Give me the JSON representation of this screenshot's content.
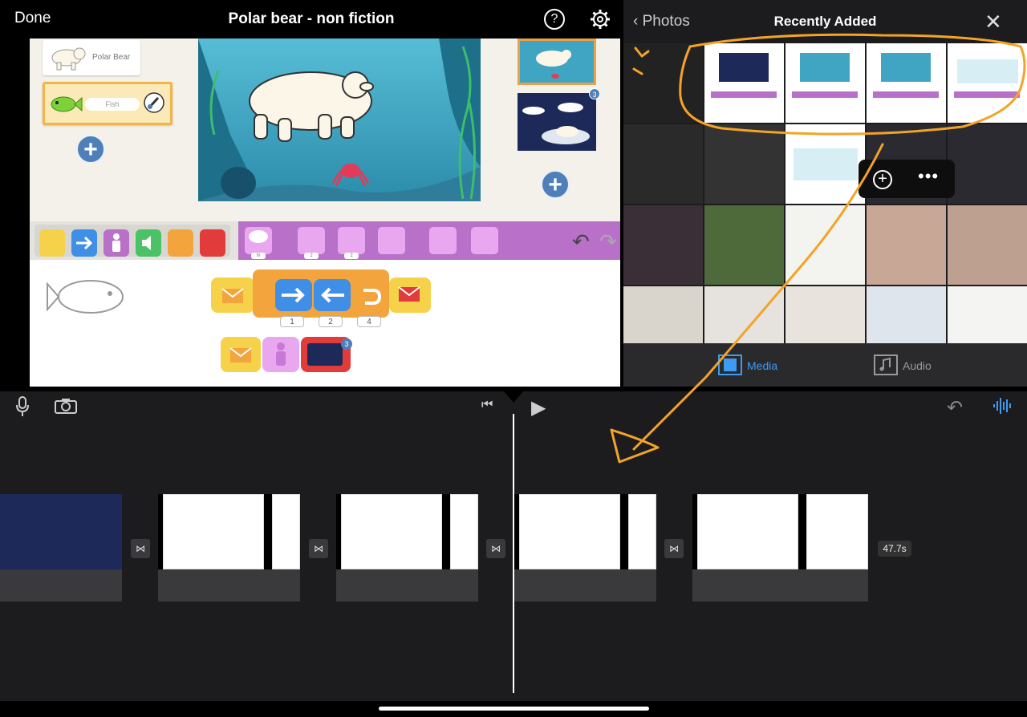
{
  "topbar": {
    "done_label": "Done",
    "title": "Polar bear - non fiction",
    "help_label": "?"
  },
  "viewer": {
    "char_cards": [
      {
        "label": "Polar Bear"
      },
      {
        "label": "Fish"
      }
    ],
    "page_badge": "3",
    "palette_tags": [
      "hi",
      "2",
      "2"
    ],
    "script_params": [
      "1",
      "2",
      "4"
    ],
    "script_badge": "3"
  },
  "media": {
    "back_label": "Photos",
    "title": "Recently Added",
    "popup_add": "+",
    "popup_more": "•••",
    "tabs": [
      {
        "label": "Media",
        "active": true,
        "color": "#3d9bf3"
      },
      {
        "label": "Audio",
        "active": false,
        "color": "#999999"
      }
    ]
  },
  "timeline": {
    "duration": "47.7s"
  },
  "colors": {
    "accent": "#3d9bf3",
    "annotation": "#f4a327"
  }
}
